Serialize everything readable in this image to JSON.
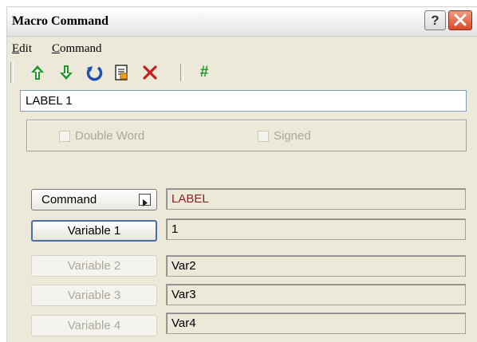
{
  "window": {
    "title": "Macro Command",
    "help_label": "?"
  },
  "menu": [
    {
      "label": "Edit",
      "underline": "E",
      "rest": "dit"
    },
    {
      "label": "Command",
      "underline": "C",
      "rest": "ommand"
    }
  ],
  "toolbar": {
    "buttons": [
      "move-up-icon",
      "move-down-icon",
      "undo-icon",
      "document-icon",
      "delete-icon"
    ],
    "hash_label": "#"
  },
  "label_field": {
    "value": "LABEL 1"
  },
  "options": {
    "double_word_label": "Double Word",
    "double_word_checked": false,
    "signed_label": "Signed",
    "signed_checked": false
  },
  "rows": [
    {
      "button": "Command",
      "value": "LABEL",
      "enabled": true
    },
    {
      "button": "Variable 1",
      "value": "1",
      "enabled": true
    },
    {
      "button": "Variable 2",
      "value": "Var2",
      "enabled": false
    },
    {
      "button": "Variable 3",
      "value": "Var3",
      "enabled": false
    },
    {
      "button": "Variable 4",
      "value": "Var4",
      "enabled": false
    }
  ],
  "colors": {
    "arrow_green": "#1a9a2a",
    "undo_blue": "#1f4fb4",
    "delete_red": "#c81e1e",
    "label_value_red": "#8b2020"
  }
}
